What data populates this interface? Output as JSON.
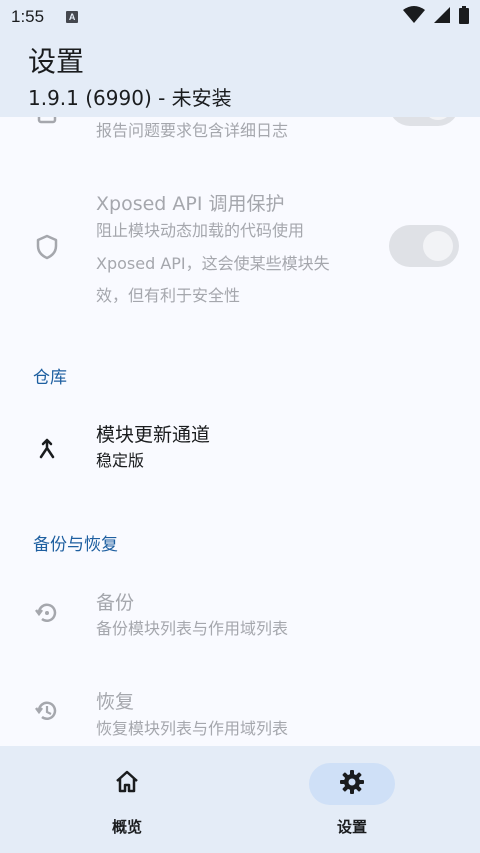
{
  "status_bar": {
    "time": "1:55",
    "notification_badge": "A"
  },
  "header": {
    "title": "设置",
    "subtitle": "1.9.1 (6990) - 未安装"
  },
  "settings": {
    "partial_item": {
      "subtitle": "报告问题要求包含详细日志",
      "toggle_on": true,
      "enabled": false
    },
    "xposed_api_protection": {
      "title": "Xposed API 调用保护",
      "subtitle_lines": [
        "阻止模块动态加载的代码使用",
        "Xposed API，这会使某些模块失",
        "效，但有利于安全性"
      ],
      "toggle_on": true,
      "enabled": false
    },
    "repository_section": "仓库",
    "update_channel": {
      "title": "模块更新通道",
      "subtitle": "稳定版"
    },
    "backup_section": "备份与恢复",
    "backup": {
      "title": "备份",
      "subtitle": "备份模块列表与作用域列表"
    },
    "restore": {
      "title": "恢复",
      "subtitle": "恢复模块列表与作用域列表"
    }
  },
  "bottom_nav": {
    "items": [
      {
        "label": "概览",
        "icon": "home-icon",
        "active": false
      },
      {
        "label": "设置",
        "icon": "settings-gear-icon",
        "active": true
      }
    ]
  },
  "colors": {
    "accent": "#1e5fa0",
    "header_bg": "#e4ecf7",
    "active_pill": "#cfe0f7"
  }
}
